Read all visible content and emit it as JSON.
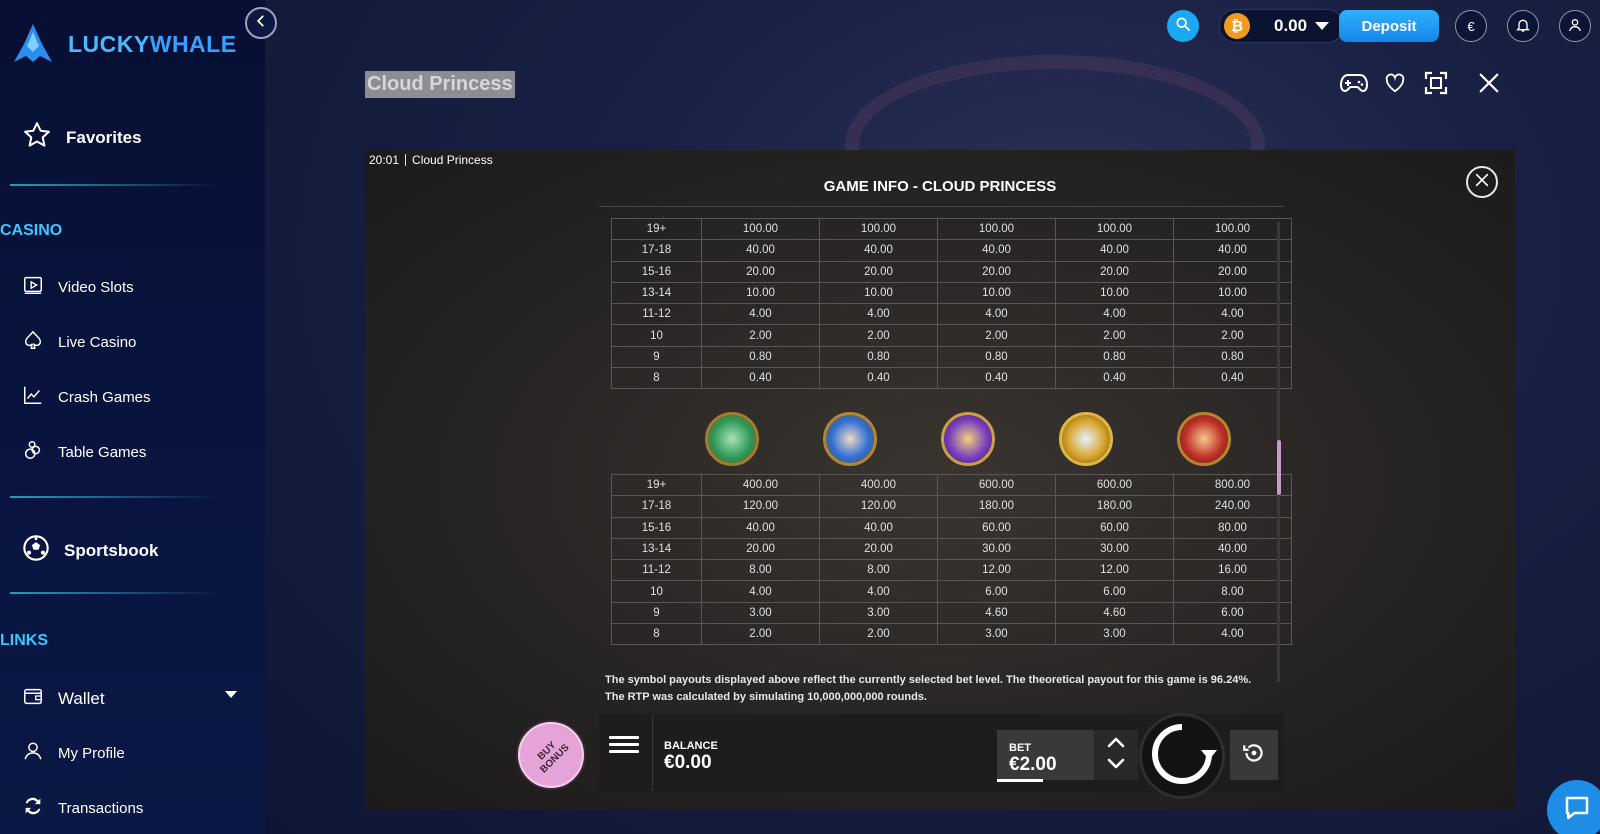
{
  "brand": {
    "name_part1": "LUCKY",
    "name_part2": "WHALE",
    "accent": "#3aa0ff"
  },
  "header": {
    "balance": "0.00",
    "currency_symbol": "€",
    "deposit_label": "Deposit",
    "coin_symbol": "₿"
  },
  "sidebar": {
    "favorites": "Favorites",
    "casino_title": "CASINO",
    "casino_items": [
      {
        "label": "Video Slots",
        "icon": "video-slots-icon"
      },
      {
        "label": "Live Casino",
        "icon": "spade-icon"
      },
      {
        "label": "Crash Games",
        "icon": "chart-icon"
      },
      {
        "label": "Table Games",
        "icon": "chips-icon"
      }
    ],
    "sportsbook": "Sportsbook",
    "links_title": "LINKS",
    "links_items": [
      {
        "label": "Wallet",
        "icon": "wallet-icon"
      },
      {
        "label": "My Profile",
        "icon": "user-icon"
      },
      {
        "label": "Transactions",
        "icon": "transactions-icon"
      }
    ]
  },
  "game": {
    "title": "Cloud Princess",
    "clock": "20:01",
    "clock_game": "Cloud Princess",
    "info_title": "GAME INFO - CLOUD PRINCESS",
    "table1": [
      {
        "label": "19+",
        "values": [
          "100.00",
          "100.00",
          "100.00",
          "100.00",
          "100.00"
        ]
      },
      {
        "label": "17-18",
        "values": [
          "40.00",
          "40.00",
          "40.00",
          "40.00",
          "40.00"
        ]
      },
      {
        "label": "15-16",
        "values": [
          "20.00",
          "20.00",
          "20.00",
          "20.00",
          "20.00"
        ]
      },
      {
        "label": "13-14",
        "values": [
          "10.00",
          "10.00",
          "10.00",
          "10.00",
          "10.00"
        ]
      },
      {
        "label": "11-12",
        "values": [
          "4.00",
          "4.00",
          "4.00",
          "4.00",
          "4.00"
        ]
      },
      {
        "label": "10",
        "values": [
          "2.00",
          "2.00",
          "2.00",
          "2.00",
          "2.00"
        ]
      },
      {
        "label": "9",
        "values": [
          "0.80",
          "0.80",
          "0.80",
          "0.80",
          "0.80"
        ]
      },
      {
        "label": "8",
        "values": [
          "0.40",
          "0.40",
          "0.40",
          "0.40",
          "0.40"
        ]
      }
    ],
    "symbols": [
      {
        "name": "green-jade-symbol-icon",
        "color": "#2e9a5a"
      },
      {
        "name": "blue-teacup-symbol-icon",
        "color": "#2f6fd6"
      },
      {
        "name": "purple-gem-symbol-icon",
        "color": "#7a3fc0"
      },
      {
        "name": "gold-scroll-symbol-icon",
        "color": "#d6a32a"
      },
      {
        "name": "red-fan-symbol-icon",
        "color": "#c0302a"
      }
    ],
    "table2": [
      {
        "label": "19+",
        "values": [
          "400.00",
          "400.00",
          "600.00",
          "600.00",
          "800.00"
        ]
      },
      {
        "label": "17-18",
        "values": [
          "120.00",
          "120.00",
          "180.00",
          "180.00",
          "240.00"
        ]
      },
      {
        "label": "15-16",
        "values": [
          "40.00",
          "40.00",
          "60.00",
          "60.00",
          "80.00"
        ]
      },
      {
        "label": "13-14",
        "values": [
          "20.00",
          "20.00",
          "30.00",
          "30.00",
          "40.00"
        ]
      },
      {
        "label": "11-12",
        "values": [
          "8.00",
          "8.00",
          "12.00",
          "12.00",
          "16.00"
        ]
      },
      {
        "label": "10",
        "values": [
          "4.00",
          "4.00",
          "6.00",
          "6.00",
          "8.00"
        ]
      },
      {
        "label": "9",
        "values": [
          "3.00",
          "3.00",
          "4.60",
          "4.60",
          "6.00"
        ]
      },
      {
        "label": "8",
        "values": [
          "2.00",
          "2.00",
          "3.00",
          "3.00",
          "4.00"
        ]
      }
    ],
    "rtp_text": "The symbol payouts displayed above reflect the currently selected bet level. The theoretical payout for this game is 96.24%. The RTP was calculated by simulating 10,000,000,000 rounds.",
    "buy_bonus": "BUY\nBONUS",
    "balance_label": "BALANCE",
    "balance_value": "€0.00",
    "bet_label": "BET",
    "bet_value": "€2.00"
  }
}
